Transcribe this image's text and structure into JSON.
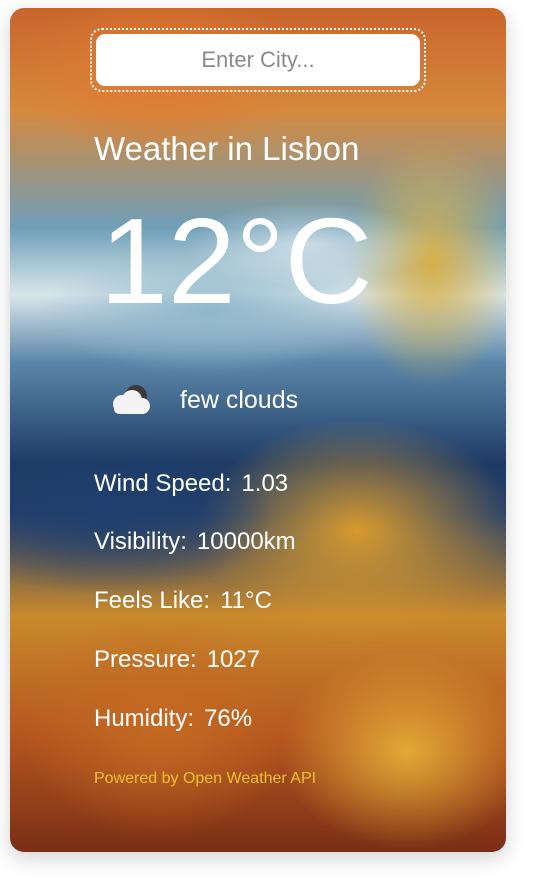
{
  "search": {
    "placeholder": "Enter City..."
  },
  "weather": {
    "title": "Weather in Lisbon",
    "temperature": "12°C",
    "condition_icon": "cloud-icon",
    "condition": "few clouds"
  },
  "stats": [
    {
      "label": "Wind Speed:",
      "value": "1.03"
    },
    {
      "label": "Visibility:",
      "value": "10000km"
    },
    {
      "label": "Feels Like:",
      "value": "11°C"
    },
    {
      "label": "Pressure:",
      "value": "1027"
    },
    {
      "label": "Humidity:",
      "value": "76%"
    }
  ],
  "footer": {
    "text": "Powered by Open Weather API"
  },
  "colors": {
    "text": "#ffffff",
    "footer": "#f2c12e",
    "input_bg": "#ffffff"
  }
}
